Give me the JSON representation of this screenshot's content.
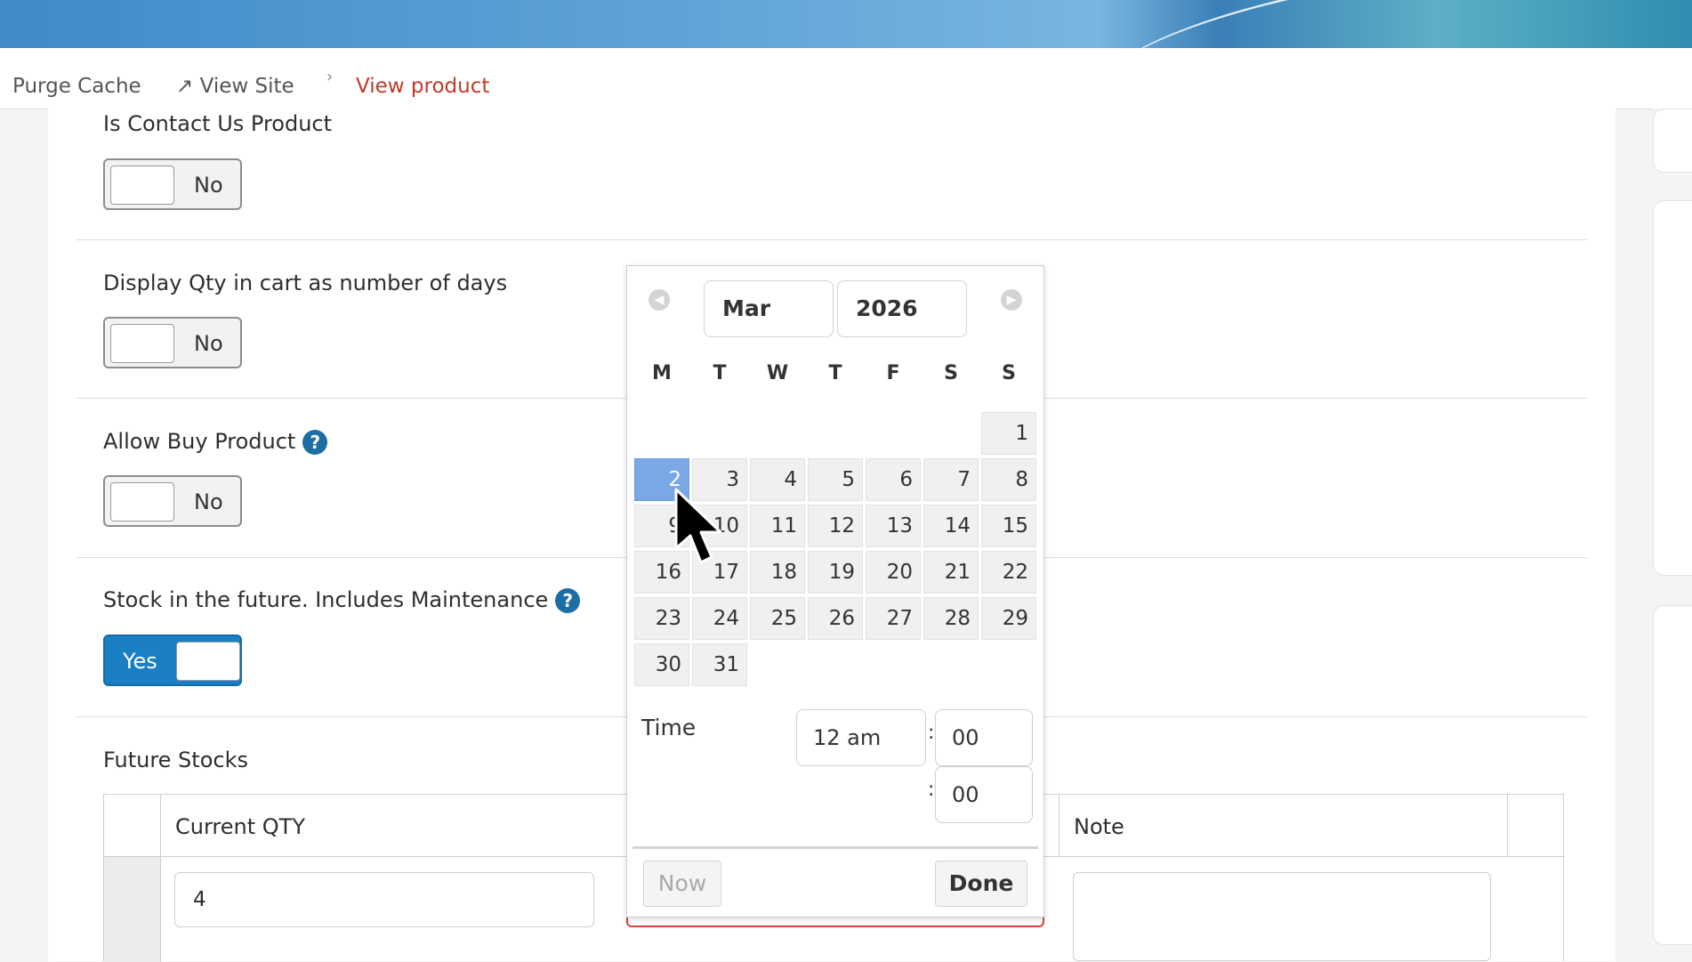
{
  "topbar": {
    "purge_cache": "Purge Cache",
    "view_site": "View Site",
    "view_site_icon": "↗",
    "breadcrumb_sep": "›",
    "breadcrumb_current": "View product"
  },
  "fields": {
    "contact_us": {
      "label": "Is Contact Us Product",
      "value": "No"
    },
    "display_qty": {
      "label": "Display Qty in cart as number of days",
      "value": "No"
    },
    "allow_buy": {
      "label": "Allow Buy Product",
      "value": "No",
      "help": "?"
    },
    "stock_future": {
      "label": "Stock in the future. Includes Maintenance",
      "value": "Yes",
      "help": "?"
    }
  },
  "future_stocks": {
    "title": "Future Stocks",
    "columns": {
      "qty": "Current QTY",
      "note": "Note"
    },
    "row": {
      "qty": "4"
    }
  },
  "datepicker": {
    "month": "Mar",
    "year": "2026",
    "dow": [
      "M",
      "T",
      "W",
      "T",
      "F",
      "S",
      "S"
    ],
    "days": [
      "1",
      "2",
      "3",
      "4",
      "5",
      "6",
      "7",
      "8",
      "9",
      "10",
      "11",
      "12",
      "13",
      "14",
      "15",
      "16",
      "17",
      "18",
      "19",
      "20",
      "21",
      "22",
      "23",
      "24",
      "25",
      "26",
      "27",
      "28",
      "29",
      "30",
      "31"
    ],
    "selected_day": "2",
    "time_label": "Time",
    "hour": "12 am",
    "minute": "00",
    "second": "00",
    "colon": ":",
    "now_label": "Now",
    "done_label": "Done"
  },
  "colors": {
    "accent": "#1a7fc4",
    "breadcrumb": "#c0392b",
    "selected_day": "#7aa7e6"
  }
}
